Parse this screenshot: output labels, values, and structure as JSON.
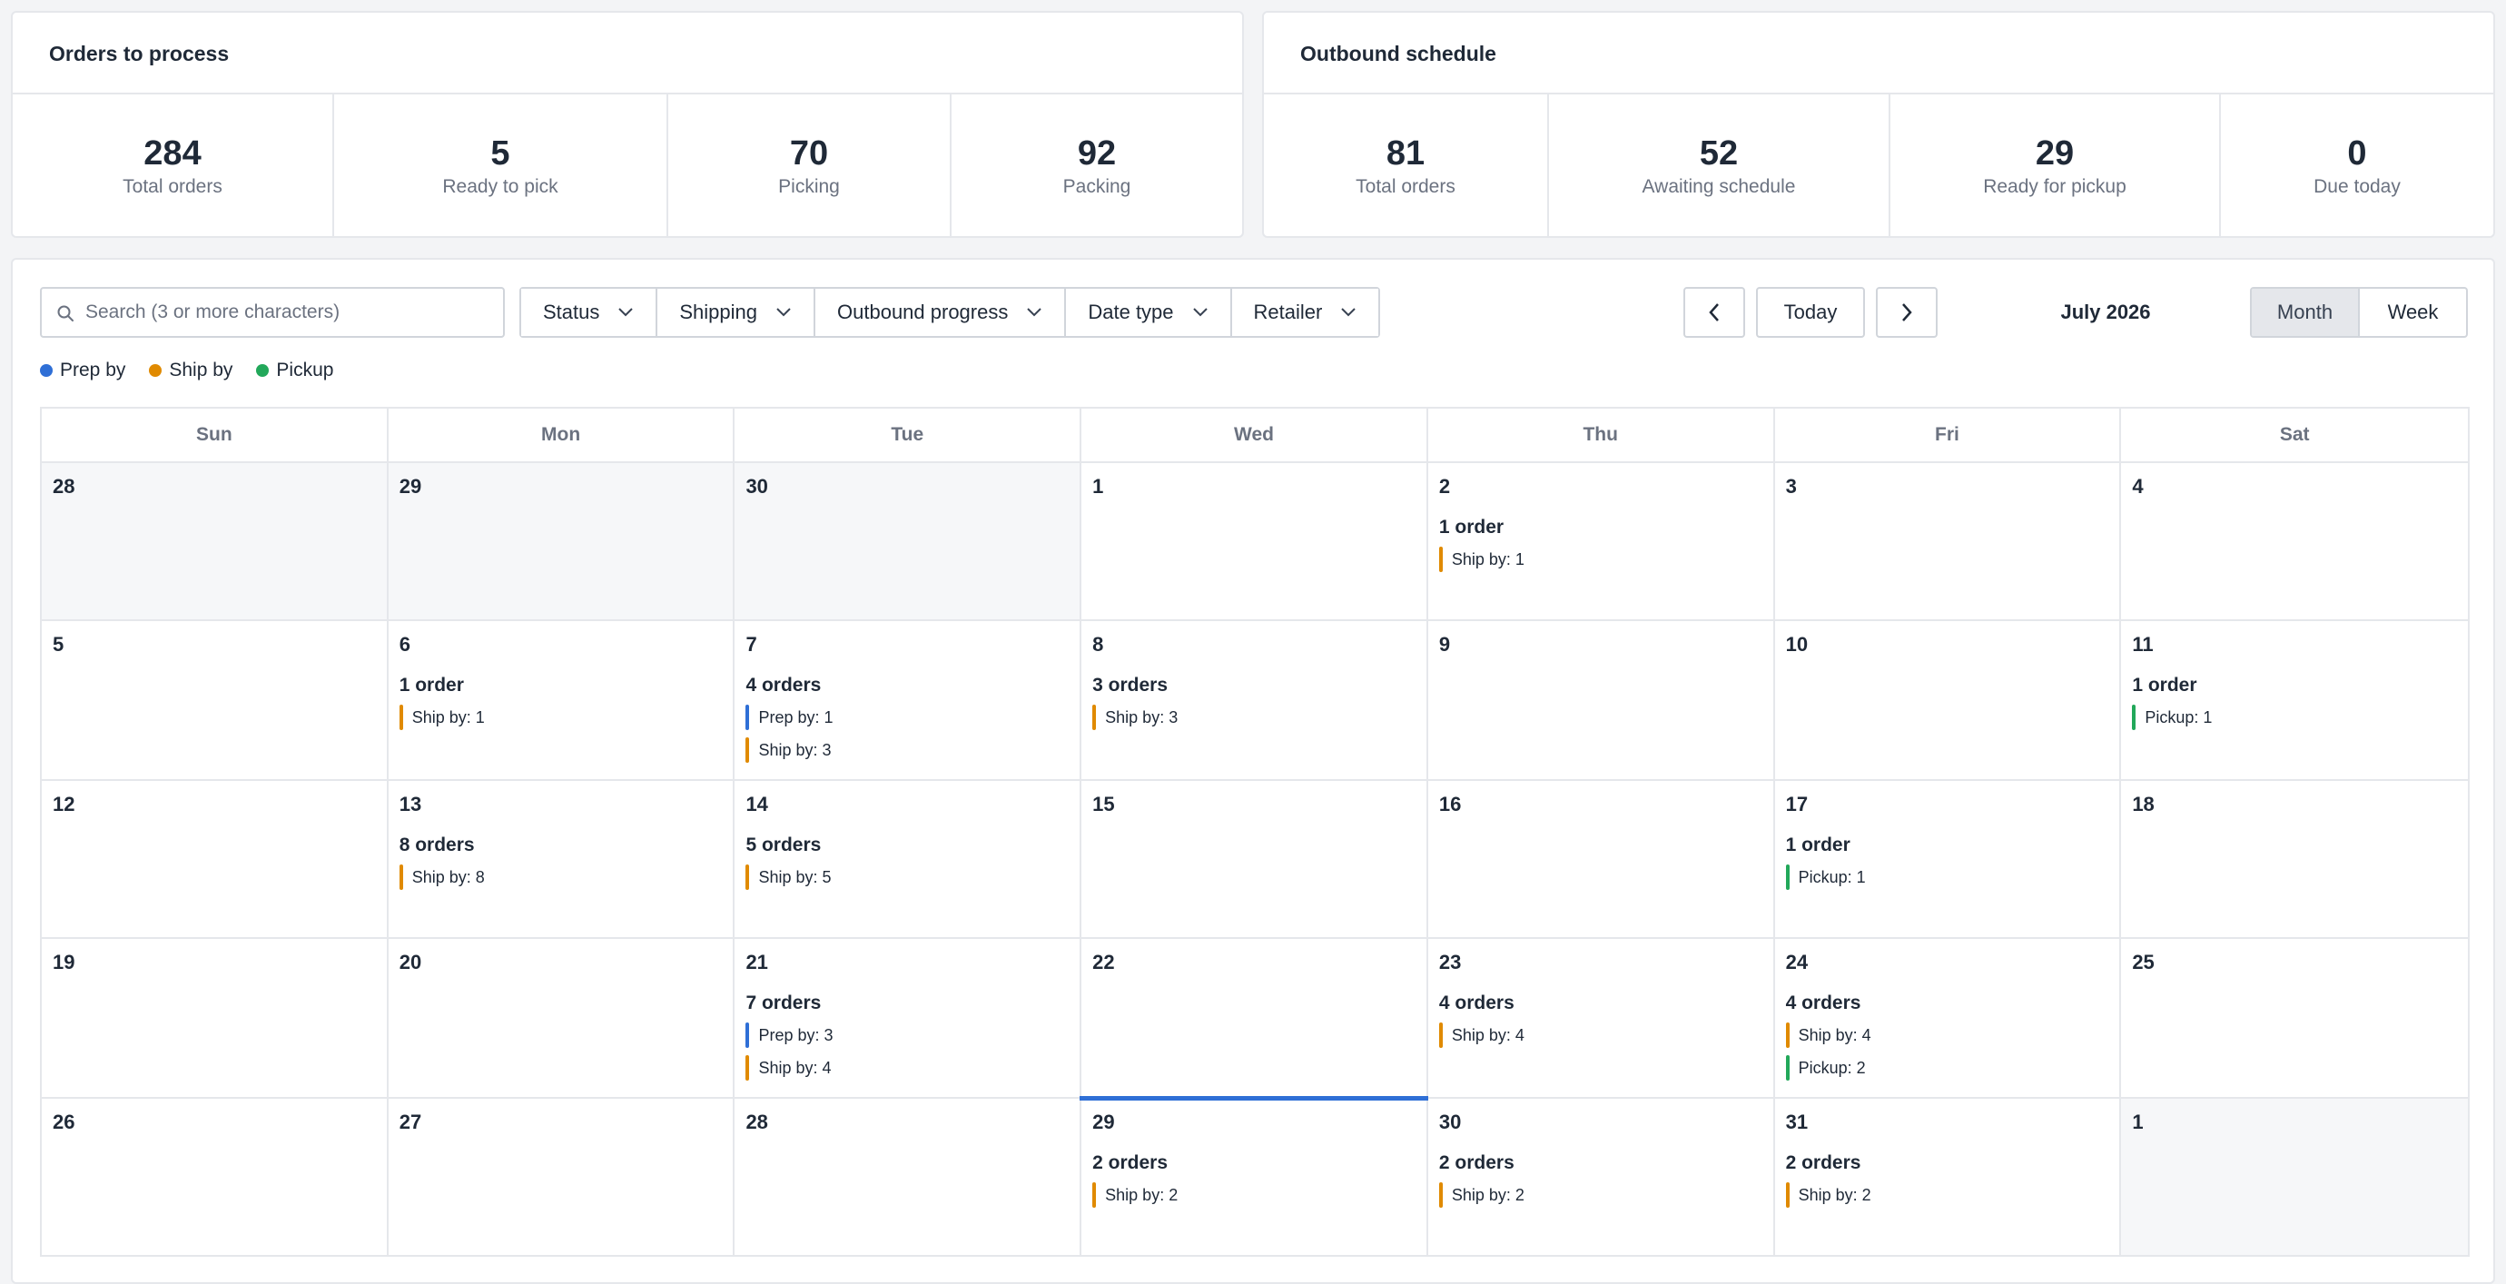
{
  "orders_panel": {
    "title": "Orders to process",
    "stats": [
      {
        "value": "284",
        "label": "Total orders"
      },
      {
        "value": "5",
        "label": "Ready to pick"
      },
      {
        "value": "70",
        "label": "Picking"
      },
      {
        "value": "92",
        "label": "Packing"
      }
    ]
  },
  "outbound_panel": {
    "title": "Outbound schedule",
    "stats": [
      {
        "value": "81",
        "label": "Total orders"
      },
      {
        "value": "52",
        "label": "Awaiting schedule"
      },
      {
        "value": "29",
        "label": "Ready for pickup"
      },
      {
        "value": "0",
        "label": "Due today"
      }
    ]
  },
  "toolbar": {
    "search_placeholder": "Search (3 or more characters)",
    "filters": [
      "Status",
      "Shipping",
      "Outbound progress",
      "Date type",
      "Retailer"
    ],
    "today_label": "Today",
    "month_label": "July 2026",
    "views": [
      "Month",
      "Week"
    ],
    "active_view": "Month"
  },
  "legend": [
    {
      "label": "Prep by",
      "color": "#2f6fd6"
    },
    {
      "label": "Ship by",
      "color": "#e08a00"
    },
    {
      "label": "Pickup",
      "color": "#22a85a"
    }
  ],
  "calendar": {
    "weekdays": [
      "Sun",
      "Mon",
      "Tue",
      "Wed",
      "Thu",
      "Fri",
      "Sat"
    ],
    "weeks": [
      [
        {
          "day": "28",
          "muted": true
        },
        {
          "day": "29",
          "muted": true
        },
        {
          "day": "30",
          "muted": true
        },
        {
          "day": "1"
        },
        {
          "day": "2",
          "count": "1 order",
          "events": [
            {
              "type": "ship",
              "label": "Ship by: 1"
            }
          ]
        },
        {
          "day": "3"
        },
        {
          "day": "4"
        }
      ],
      [
        {
          "day": "5"
        },
        {
          "day": "6",
          "count": "1 order",
          "events": [
            {
              "type": "ship",
              "label": "Ship by: 1"
            }
          ]
        },
        {
          "day": "7",
          "count": "4 orders",
          "events": [
            {
              "type": "prep",
              "label": "Prep by: 1"
            },
            {
              "type": "ship",
              "label": "Ship by: 3"
            }
          ]
        },
        {
          "day": "8",
          "count": "3 orders",
          "events": [
            {
              "type": "ship",
              "label": "Ship by: 3"
            }
          ]
        },
        {
          "day": "9"
        },
        {
          "day": "10"
        },
        {
          "day": "11",
          "count": "1 order",
          "events": [
            {
              "type": "pickup",
              "label": "Pickup: 1"
            }
          ]
        }
      ],
      [
        {
          "day": "12"
        },
        {
          "day": "13",
          "count": "8 orders",
          "events": [
            {
              "type": "ship",
              "label": "Ship by: 8"
            }
          ]
        },
        {
          "day": "14",
          "count": "5 orders",
          "events": [
            {
              "type": "ship",
              "label": "Ship by: 5"
            }
          ]
        },
        {
          "day": "15"
        },
        {
          "day": "16"
        },
        {
          "day": "17",
          "count": "1 order",
          "events": [
            {
              "type": "pickup",
              "label": "Pickup: 1"
            }
          ]
        },
        {
          "day": "18"
        }
      ],
      [
        {
          "day": "19"
        },
        {
          "day": "20"
        },
        {
          "day": "21",
          "count": "7 orders",
          "events": [
            {
              "type": "prep",
              "label": "Prep by: 3"
            },
            {
              "type": "ship",
              "label": "Ship by: 4"
            }
          ]
        },
        {
          "day": "22"
        },
        {
          "day": "23",
          "count": "4 orders",
          "events": [
            {
              "type": "ship",
              "label": "Ship by: 4"
            }
          ]
        },
        {
          "day": "24",
          "count": "4 orders",
          "events": [
            {
              "type": "ship",
              "label": "Ship by: 4"
            },
            {
              "type": "pickup",
              "label": "Pickup: 2"
            }
          ]
        },
        {
          "day": "25"
        }
      ],
      [
        {
          "day": "26"
        },
        {
          "day": "27"
        },
        {
          "day": "28"
        },
        {
          "day": "29",
          "today": true,
          "count": "2 orders",
          "events": [
            {
              "type": "ship",
              "label": "Ship by: 2"
            }
          ]
        },
        {
          "day": "30",
          "count": "2 orders",
          "events": [
            {
              "type": "ship",
              "label": "Ship by: 2"
            }
          ]
        },
        {
          "day": "31",
          "count": "2 orders",
          "events": [
            {
              "type": "ship",
              "label": "Ship by: 2"
            }
          ]
        },
        {
          "day": "1",
          "muted": true
        }
      ]
    ]
  },
  "event_colors": {
    "prep": "#2f6fd6",
    "ship": "#e08a00",
    "pickup": "#22a85a"
  }
}
